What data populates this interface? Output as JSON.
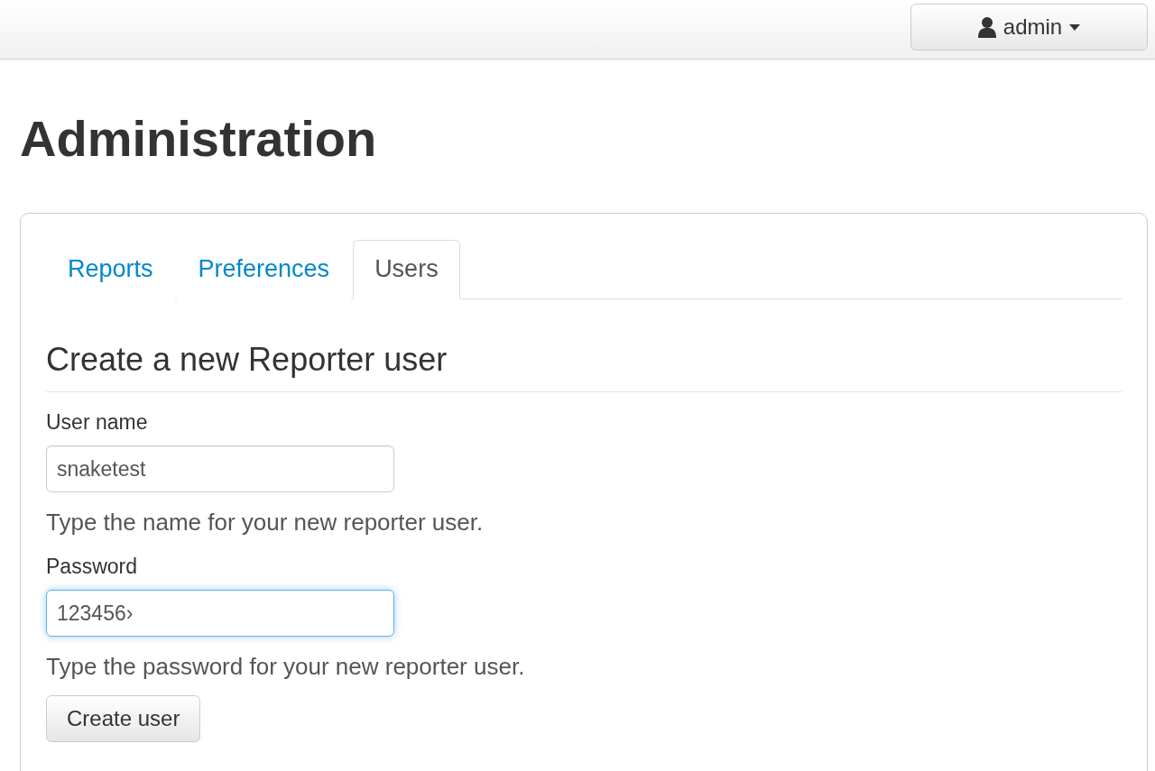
{
  "navbar": {
    "user_menu": {
      "label": "admin"
    }
  },
  "page_title": "Administration",
  "tabs": [
    {
      "label": "Reports",
      "selected": false
    },
    {
      "label": "Preferences",
      "selected": false
    },
    {
      "label": "Users",
      "selected": true
    }
  ],
  "form": {
    "heading": "Create a new Reporter user",
    "fields": [
      {
        "label": "User name",
        "value": "snaketest",
        "help": "Type the name for your new reporter user.",
        "focused": false
      },
      {
        "label": "Password",
        "value": "123456›",
        "help": "Type the password for your new reporter user.",
        "focused": true
      }
    ],
    "submit": "Create user"
  }
}
